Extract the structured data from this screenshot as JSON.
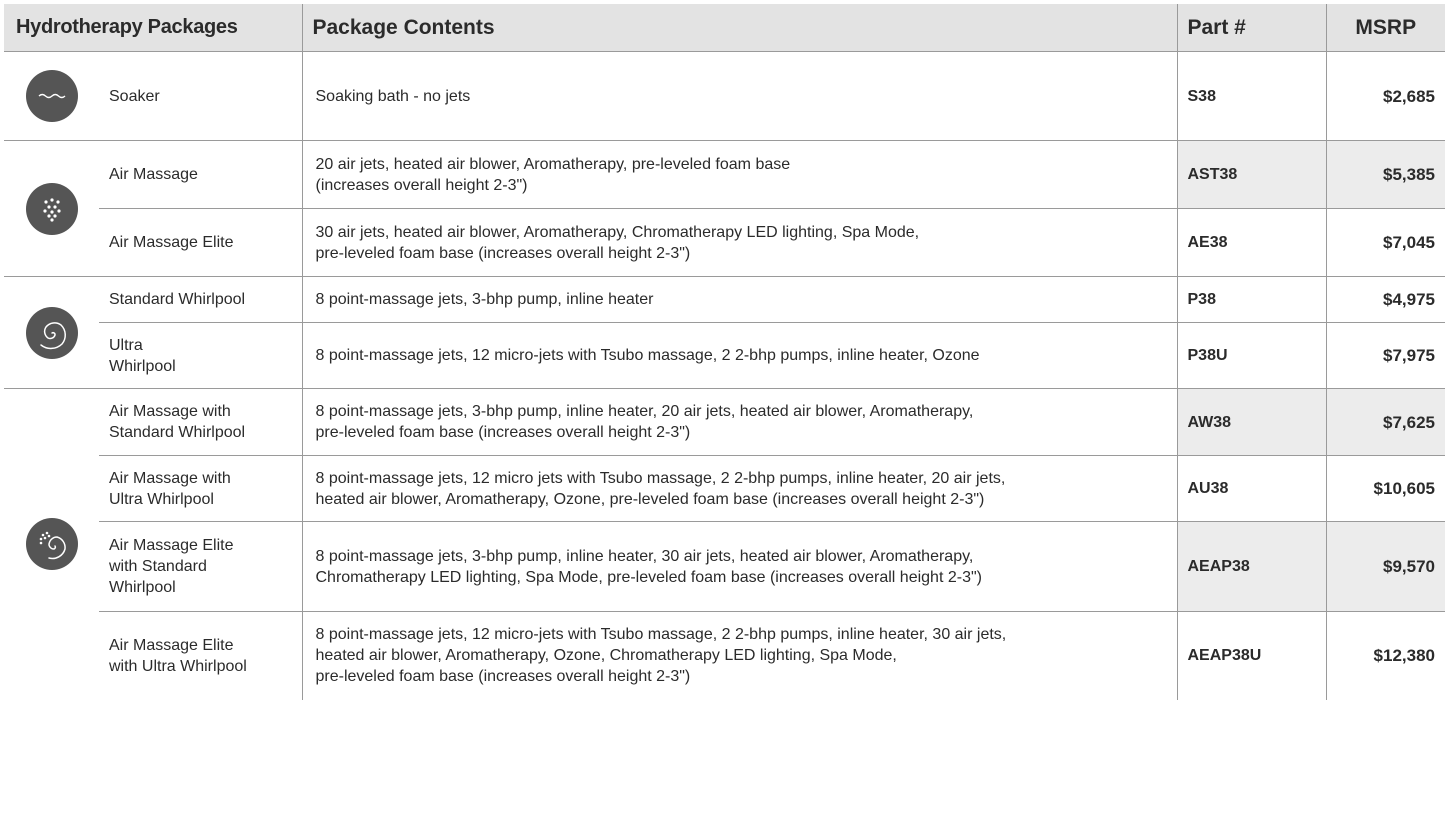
{
  "headers": {
    "packages": "Hydrotherapy Packages",
    "contents": "Package Contents",
    "part": "Part #",
    "msrp": "MSRP"
  },
  "groups": [
    {
      "icon": "wave-icon",
      "rows": [
        {
          "name": "Soaker",
          "contents": [
            "Soaking bath - no jets"
          ],
          "part": "S38",
          "msrp": "$2,685"
        }
      ]
    },
    {
      "icon": "air-bubbles-icon",
      "rows": [
        {
          "name": "Air Massage",
          "contents": [
            "20 air jets, heated air blower, Aromatherapy, pre-leveled foam base",
            "(increases overall height 2-3\")"
          ],
          "part": "AST38",
          "msrp": "$5,385"
        },
        {
          "name": "Air Massage Elite",
          "contents": [
            "30 air jets, heated air blower, Aromatherapy, Chromatherapy LED lighting, Spa Mode,",
            "pre-leveled foam base (increases overall height 2-3\")"
          ],
          "part": "AE38",
          "msrp": "$7,045"
        }
      ]
    },
    {
      "icon": "whirlpool-spiral-icon",
      "rows": [
        {
          "name": "Standard Whirlpool",
          "contents": [
            "8 point-massage jets, 3-bhp pump, inline heater"
          ],
          "part": "P38",
          "msrp": "$4,975"
        },
        {
          "name": "Ultra\nWhirlpool",
          "contents": [
            "8 point-massage jets, 12 micro-jets with Tsubo massage, 2 2-bhp pumps, inline heater, Ozone"
          ],
          "part": "P38U",
          "msrp": "$7,975"
        }
      ]
    },
    {
      "icon": "air-whirlpool-combo-icon",
      "rows": [
        {
          "name": "Air Massage with\nStandard Whirlpool",
          "contents": [
            "8 point-massage jets, 3-bhp pump, inline heater, 20 air jets, heated air blower, Aromatherapy,",
            "pre-leveled foam base (increases overall height 2-3\")"
          ],
          "part": "AW38",
          "msrp": "$7,625"
        },
        {
          "name": "Air Massage with\nUltra Whirlpool",
          "contents": [
            "8 point-massage jets, 12 micro jets with Tsubo massage, 2 2-bhp pumps, inline heater, 20 air jets,",
            "heated air blower, Aromatherapy, Ozone, pre-leveled foam base (increases overall height 2-3\")"
          ],
          "part": "AU38",
          "msrp": "$10,605"
        },
        {
          "name": "Air Massage Elite\nwith Standard\nWhirlpool",
          "contents": [
            "8 point-massage jets, 3-bhp pump, inline heater, 30 air jets, heated air blower, Aromatherapy,",
            "Chromatherapy LED lighting, Spa Mode, pre-leveled foam base (increases overall height 2-3\")"
          ],
          "part": "AEAP38",
          "msrp": "$9,570"
        },
        {
          "name": "Air Massage Elite\nwith Ultra Whirlpool",
          "contents": [
            "8 point-massage jets, 12 micro-jets with Tsubo massage, 2 2-bhp pumps, inline heater, 30 air jets,",
            "heated air blower, Aromatherapy, Ozone, Chromatherapy LED lighting, Spa Mode,",
            "pre-leveled foam base (increases overall height 2-3\")"
          ],
          "part": "AEAP38U",
          "msrp": "$12,380"
        }
      ]
    }
  ],
  "colors": {
    "header_bg": "#e3e3e3",
    "shaded_cell": "#ececec",
    "icon_bg": "#555555",
    "rule": "#9a9a9a"
  }
}
